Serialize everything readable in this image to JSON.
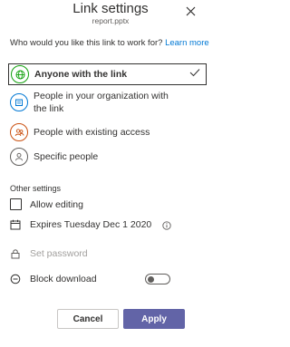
{
  "header": {
    "title": "Link settings",
    "subtitle": "report.pptx"
  },
  "question": {
    "text": "Who would you like this link to work for?",
    "learn_more": "Learn more"
  },
  "options": [
    {
      "label": "Anyone with the link",
      "icon": "globe-icon",
      "color": "#13a10e",
      "selected": true
    },
    {
      "label": "People in your organization with the link",
      "icon": "building-icon",
      "color": "#0078d4",
      "selected": false
    },
    {
      "label": "People with existing access",
      "icon": "people-icon",
      "color": "#ca5010",
      "selected": false
    },
    {
      "label": "Specific people",
      "icon": "person-icon",
      "color": "#605e5c",
      "selected": false
    }
  ],
  "other_settings": {
    "heading": "Other settings",
    "allow_editing": "Allow editing",
    "expires": "Expires Tuesday Dec 1 2020",
    "password_placeholder": "Set password",
    "block_download": "Block download",
    "block_download_on": false
  },
  "actions": {
    "cancel": "Cancel",
    "apply": "Apply"
  },
  "colors": {
    "accent": "#6264a7",
    "link": "#0078d4"
  }
}
